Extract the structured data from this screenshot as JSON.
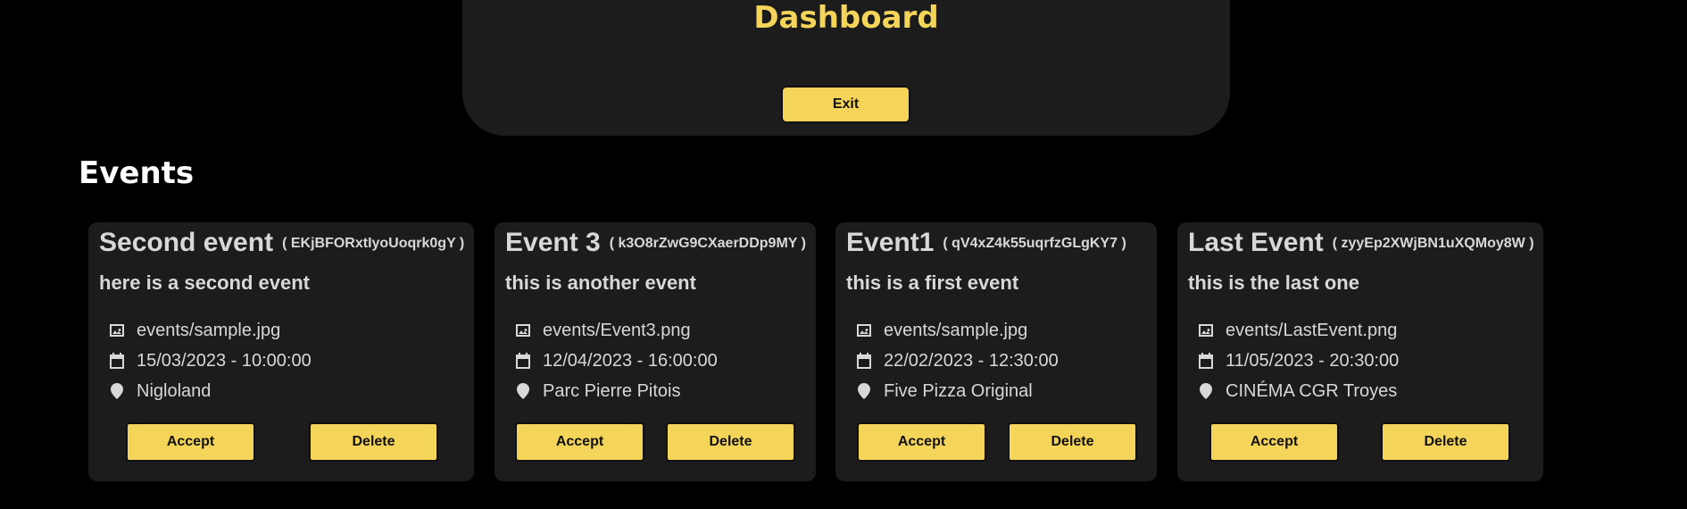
{
  "header": {
    "title": "Dashboard",
    "exit_label": "Exit"
  },
  "events_section": {
    "title": "Events"
  },
  "events": [
    {
      "name": "Second event",
      "id": "( EKjBFORxtIyoUoqrk0gY )",
      "description": "here is a second event",
      "image": "events/sample.jpg",
      "datetime": "15/03/2023 - 10:00:00",
      "location": "Nigloland",
      "accept_label": "Accept",
      "delete_label": "Delete"
    },
    {
      "name": "Event 3",
      "id": "( k3O8rZwG9CXaerDDp9MY )",
      "description": "this is another event",
      "image": "events/Event3.png",
      "datetime": "12/04/2023 - 16:00:00",
      "location": "Parc Pierre Pitois",
      "accept_label": "Accept",
      "delete_label": "Delete"
    },
    {
      "name": "Event1",
      "id": "( qV4xZ4k55uqrfzGLgKY7 )",
      "description": "this is a first event",
      "image": "events/sample.jpg",
      "datetime": "22/02/2023 - 12:30:00",
      "location": "Five Pizza Original",
      "accept_label": "Accept",
      "delete_label": "Delete"
    },
    {
      "name": "Last Event",
      "id": "( zyyEp2XWjBN1uXQMoy8W )",
      "description": "this is the last one",
      "image": "events/LastEvent.png",
      "datetime": "11/05/2023 - 20:30:00",
      "location": "CINÉMA CGR Troyes",
      "accept_label": "Accept",
      "delete_label": "Delete"
    }
  ],
  "icons": {
    "image": "image-icon",
    "date": "calendar-icon",
    "location": "location-pin-icon"
  },
  "colors": {
    "accent": "#f5d45a",
    "background": "#000000",
    "panel": "#1c1c1c",
    "text": "#d8d8d8"
  }
}
